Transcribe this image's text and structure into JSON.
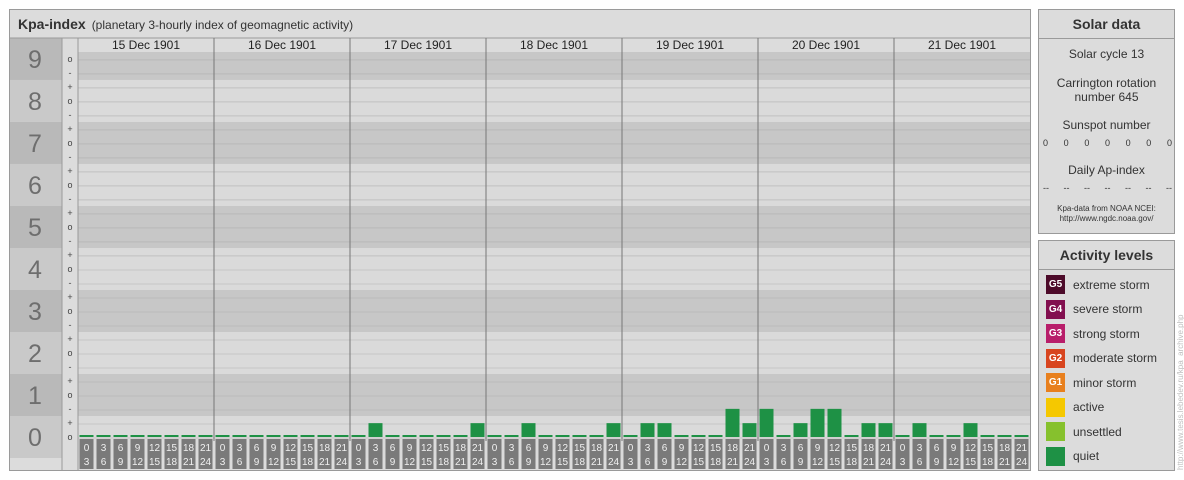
{
  "header": {
    "title": "Kpa-index",
    "subtitle": "(planetary 3-hourly index of geomagnetic activity)"
  },
  "chart_data": {
    "type": "bar",
    "title": "Kpa-index",
    "subtitle": "(planetary 3-hourly index of geomagnetic activity)",
    "ylim": [
      0,
      9
    ],
    "y_major_ticks": [
      "0",
      "1",
      "2",
      "3",
      "4",
      "5",
      "6",
      "7",
      "8",
      "9"
    ],
    "y_minor_ticks": [
      "o",
      "+",
      "-"
    ],
    "days": [
      "15 Dec 1901",
      "16 Dec 1901",
      "17 Dec 1901",
      "18 Dec 1901",
      "19 Dec 1901",
      "20 Dec 1901",
      "21 Dec 1901"
    ],
    "interval_labels": [
      [
        "0",
        "3"
      ],
      [
        "3",
        "6"
      ],
      [
        "6",
        "9"
      ],
      [
        "9",
        "12"
      ],
      [
        "12",
        "15"
      ],
      [
        "15",
        "18"
      ],
      [
        "18",
        "21"
      ],
      [
        "21",
        "24"
      ]
    ],
    "values": [
      [
        0,
        0,
        0,
        0,
        0,
        0,
        0,
        0
      ],
      [
        0,
        0,
        0,
        0,
        0,
        0,
        0,
        0
      ],
      [
        0,
        0.33,
        0,
        0,
        0,
        0,
        0,
        0.33
      ],
      [
        0,
        0,
        0.33,
        0,
        0,
        0,
        0,
        0.33
      ],
      [
        0,
        0.33,
        0.33,
        0,
        0,
        0,
        0.67,
        0.33
      ],
      [
        0.67,
        0,
        0.33,
        0.67,
        0.67,
        0,
        0.33,
        0.33
      ],
      [
        0,
        0.33,
        0,
        0,
        0.33,
        0,
        0,
        0
      ]
    ],
    "bar_color": "#1e9145",
    "grid": true
  },
  "solar": {
    "title": "Solar data",
    "cycle": "Solar cycle 13",
    "rotation_line1": "Carrington rotation",
    "rotation_line2": "number 645",
    "sunspot_label": "Sunspot number",
    "sunspot_values": [
      "0",
      "0",
      "0",
      "0",
      "0",
      "0",
      "0"
    ],
    "ap_label": "Daily Ap-index",
    "ap_values": [
      "--",
      "--",
      "--",
      "--",
      "--",
      "--",
      "--"
    ],
    "source_line1": "Kpa-data from NOAA NCEI:",
    "source_line2": "http://www.ngdc.noaa.gov/"
  },
  "activity": {
    "title": "Activity levels",
    "levels": [
      {
        "badge": "G5",
        "label": "extreme storm",
        "color": "#4d0b2a"
      },
      {
        "badge": "G4",
        "label": "severe storm",
        "color": "#820f4f"
      },
      {
        "badge": "G3",
        "label": "strong storm",
        "color": "#b81e6a"
      },
      {
        "badge": "G2",
        "label": "moderate storm",
        "color": "#d8451f"
      },
      {
        "badge": "G1",
        "label": "minor storm",
        "color": "#e8801e"
      },
      {
        "badge": "",
        "label": "active",
        "color": "#f5c800"
      },
      {
        "badge": "",
        "label": "unsettled",
        "color": "#86c12d"
      },
      {
        "badge": "",
        "label": "quiet",
        "color": "#1e9145"
      }
    ]
  },
  "watermark": "http://www.tesis.lebedev.ru/kpa_archive.php"
}
